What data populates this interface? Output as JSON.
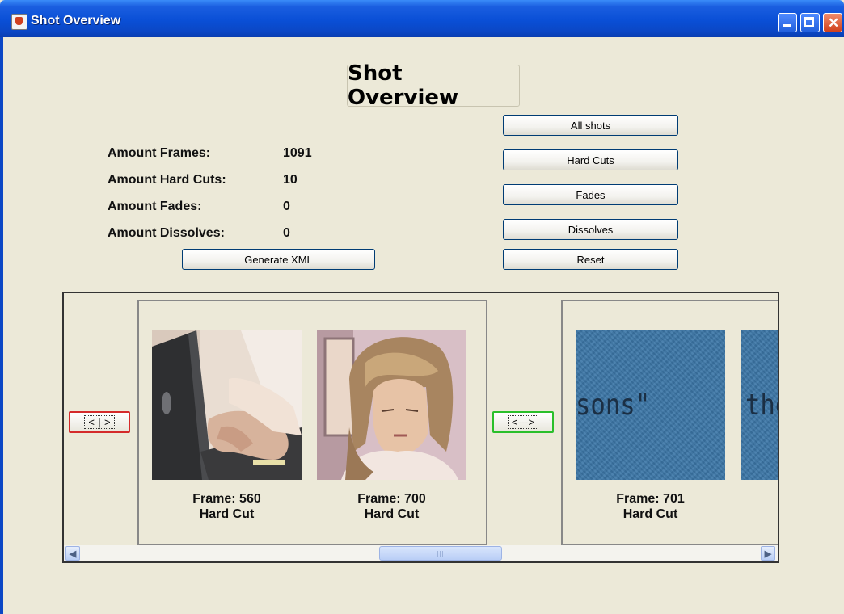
{
  "window": {
    "title": "Shot Overview"
  },
  "heading": "Shot Overview",
  "stats": [
    {
      "label": "Amount Frames:",
      "value": "1091"
    },
    {
      "label": "Amount Hard Cuts:",
      "value": "10"
    },
    {
      "label": "Amount Fades:",
      "value": "0"
    },
    {
      "label": "Amount Dissolves:",
      "value": "0"
    }
  ],
  "buttons": {
    "generate_xml": "Generate XML",
    "all_shots": "All shots",
    "hard_cuts": "Hard Cuts",
    "fades": "Fades",
    "dissolves": "Dissolves",
    "reset": "Reset"
  },
  "viewer": {
    "nav_prev_label": "<-|->",
    "nav_next_label": "<--->",
    "shots": [
      {
        "frame_text": "Frame: 560",
        "type": "Hard Cut"
      },
      {
        "frame_text": "Frame: 700",
        "type": "Hard Cut"
      },
      {
        "frame_text": "Frame: 701",
        "type": "Hard Cut"
      }
    ],
    "thumb_texts": [
      "sons\"",
      "the"
    ]
  },
  "colors": {
    "window_bg": "#ECE9D8",
    "titlebar": "#0A4FD6",
    "nav_prev_border": "#D42A2A",
    "nav_next_border": "#2ABF2A"
  }
}
